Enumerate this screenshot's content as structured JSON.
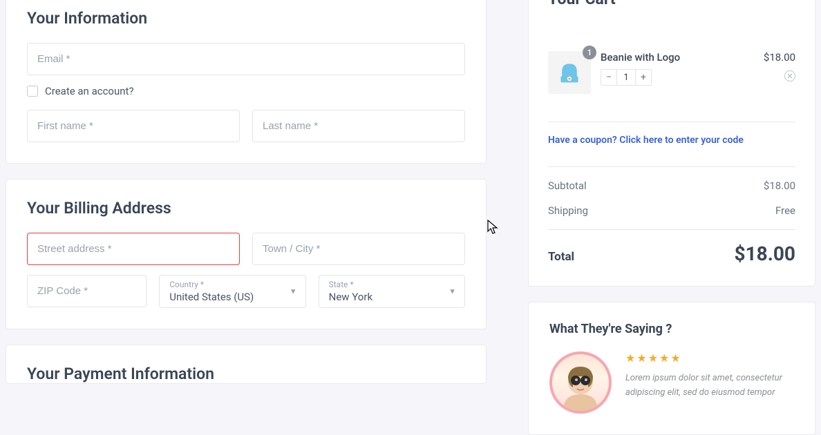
{
  "info": {
    "heading": "Your Information",
    "email_placeholder": "Email *",
    "create_account_label": "Create an account?",
    "first_name_placeholder": "First name *",
    "last_name_placeholder": "Last name *"
  },
  "billing": {
    "heading": "Your Billing Address",
    "street_placeholder": "Street address *",
    "city_placeholder": "Town / City *",
    "zip_placeholder": "ZIP Code *",
    "country_label": "Country *",
    "country_value": "United States (US)",
    "state_label": "State *",
    "state_value": "New York"
  },
  "payment": {
    "heading": "Your Payment Information"
  },
  "cart": {
    "heading": "Your Cart",
    "item": {
      "name": "Beanie with Logo",
      "badge_qty": "1",
      "qty": "1",
      "price": "$18.00"
    },
    "coupon_text": "Have a coupon? Click here to enter your code",
    "subtotal_label": "Subtotal",
    "subtotal_value": "$18.00",
    "shipping_label": "Shipping",
    "shipping_value": "Free",
    "total_label": "Total",
    "total_value": "$18.00"
  },
  "testimonial": {
    "heading": "What They're Saying ?",
    "stars": "★★★★★",
    "quote": "Lorem ipsum dolor sit amet, consectetur adipiscing elit, sed do eiusmod tempor"
  }
}
